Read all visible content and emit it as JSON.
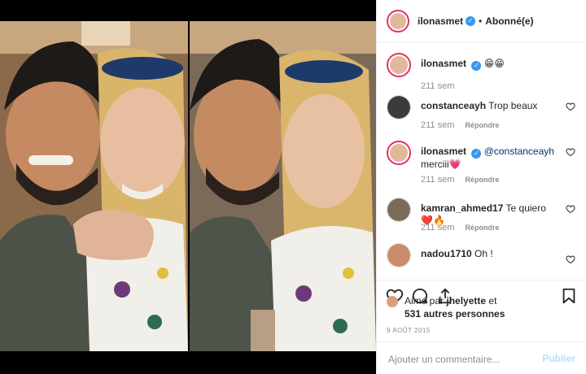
{
  "post": {
    "author": "ilonasmet",
    "follow_state": "Abonné(e)",
    "separator": "•",
    "verified_glyph": "✓",
    "caption_text": "😁😁",
    "caption_time": "211 sem"
  },
  "comments": [
    {
      "user": "constanceayh",
      "mention": "",
      "text": "Trop beaux",
      "time": "211 sem",
      "reply": "Répondre",
      "avatar_color": "#3b3b3b"
    },
    {
      "user": "ilonasmet",
      "mention": "@constanceayh",
      "text": "merciii💗",
      "time": "211 sem",
      "reply": "Répondre",
      "avatar_color": "#e0b89a"
    },
    {
      "user": "kamran_ahmed17",
      "mention": "",
      "text": "Te quiero ❤️🔥",
      "time": "211 sem",
      "reply": "Répondre",
      "avatar_color": "#7d6a59"
    },
    {
      "user": "nadou1710",
      "mention": "",
      "text": "Oh !",
      "time": "",
      "reply": "",
      "avatar_color": "#c98b6c"
    }
  ],
  "likes": {
    "prefix": "Aimé par",
    "user": "jhelyette",
    "connector": "et",
    "others": "531 autres personnes"
  },
  "date": "9 AOÛT 2015",
  "add_comment": {
    "placeholder": "Ajouter un commentaire...",
    "publish_label": "Publier"
  },
  "icons": [
    "heart-icon",
    "comment-icon",
    "share-icon",
    "bookmark-icon",
    "verified-icon"
  ],
  "colors": {
    "accent": "#3897f0",
    "muted": "#8e8e8e",
    "text": "#262626",
    "publish_disabled": "#b2dffc",
    "story_ring": "#e1306c"
  }
}
